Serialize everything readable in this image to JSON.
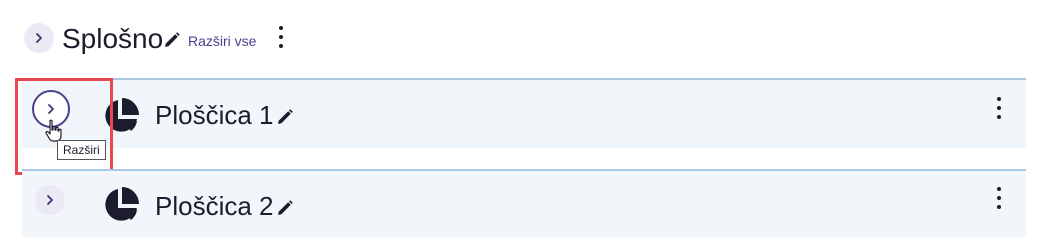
{
  "section": {
    "title": "Splošno",
    "expand_all_label": "Razširi vse"
  },
  "tiles": [
    {
      "title": "Ploščica 1"
    },
    {
      "title": "Ploščica 2"
    }
  ],
  "tooltip": {
    "text": "Razširi"
  },
  "colors": {
    "accent": "#4a3f8a",
    "tile_bg": "#f1f6fb",
    "tile_border": "#a9c8e3",
    "highlight": "#e44a4f"
  }
}
